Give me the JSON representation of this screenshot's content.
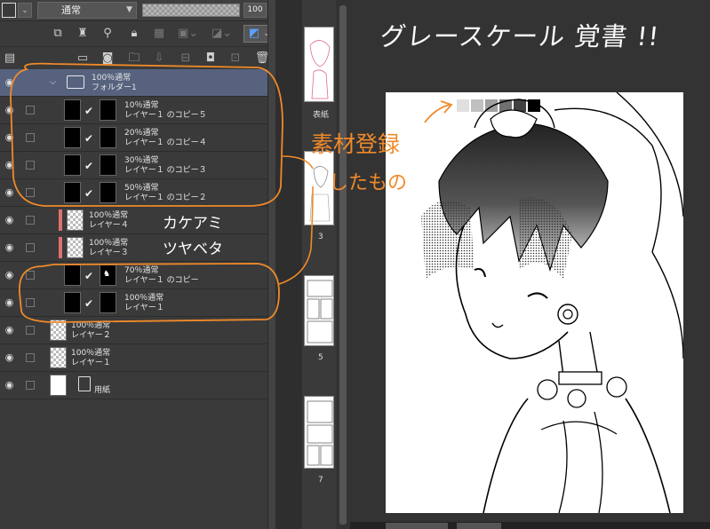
{
  "toolbar": {
    "blend_mode": "通常",
    "opacity_value": "100",
    "opacity_fraction": 1.0,
    "row1_icons": [
      "new-raster-layer-icon",
      "lighthouse-icon",
      "reference-icon",
      "lock-icon",
      "lock-alpha-icon",
      "clip-icon",
      "mask-icon",
      "color-swatch-icon"
    ],
    "row2_icons": [
      "layer-panel-icon",
      "new-layer-icon",
      "new-vector-icon",
      "new-folder-icon",
      "transfer-down-icon",
      "merge-icon",
      "mask-create-icon",
      "mask-apply-icon",
      "delete-icon"
    ]
  },
  "layers": [
    {
      "kind": "folder",
      "line1": "100％通常",
      "line2": "フォルダー1"
    },
    {
      "kind": "mask",
      "line1": "10％通常",
      "line2": "レイヤー１ のコピー５"
    },
    {
      "kind": "mask",
      "line1": "20％通常",
      "line2": "レイヤー１ のコピー４"
    },
    {
      "kind": "mask",
      "line1": "30％通常",
      "line2": "レイヤー１ のコピー３"
    },
    {
      "kind": "mask",
      "line1": "50％通常",
      "line2": "レイヤー１ のコピー２"
    },
    {
      "kind": "tagged",
      "line1": "100％通常",
      "line2": "レイヤー４"
    },
    {
      "kind": "tagged",
      "line1": "100％通常",
      "line2": "レイヤー３"
    },
    {
      "kind": "mask-fig",
      "line1": "70％通常",
      "line2": "レイヤー１ のコピー"
    },
    {
      "kind": "mask",
      "line1": "100％通常",
      "line2": "レイヤー１"
    },
    {
      "kind": "plain",
      "line1": "100％通常",
      "line2": "レイヤー２"
    },
    {
      "kind": "plain",
      "line1": "100％通常",
      "line2": "レイヤー１"
    },
    {
      "kind": "paper",
      "line1": "",
      "line2": "用紙"
    }
  ],
  "annotations": {
    "karakami": "カケアミ",
    "tsuyabeta": "ツヤベタ",
    "sozai_line1": "素材登録",
    "sozai_line2": "したもの",
    "title": "グレースケール 覚書 !!"
  },
  "pages": [
    {
      "label": "表紙"
    },
    {
      "label": "3"
    },
    {
      "label": "5"
    },
    {
      "label": "7"
    }
  ],
  "colors": {
    "accent_orange": "#f08a2a",
    "folder_row": "#56627e",
    "tag_red": "#e07070"
  },
  "gray_swatches": [
    "#e0e0e0",
    "#c0c0c0",
    "#a0a0a0",
    "#707070",
    "#404040",
    "#000000"
  ]
}
